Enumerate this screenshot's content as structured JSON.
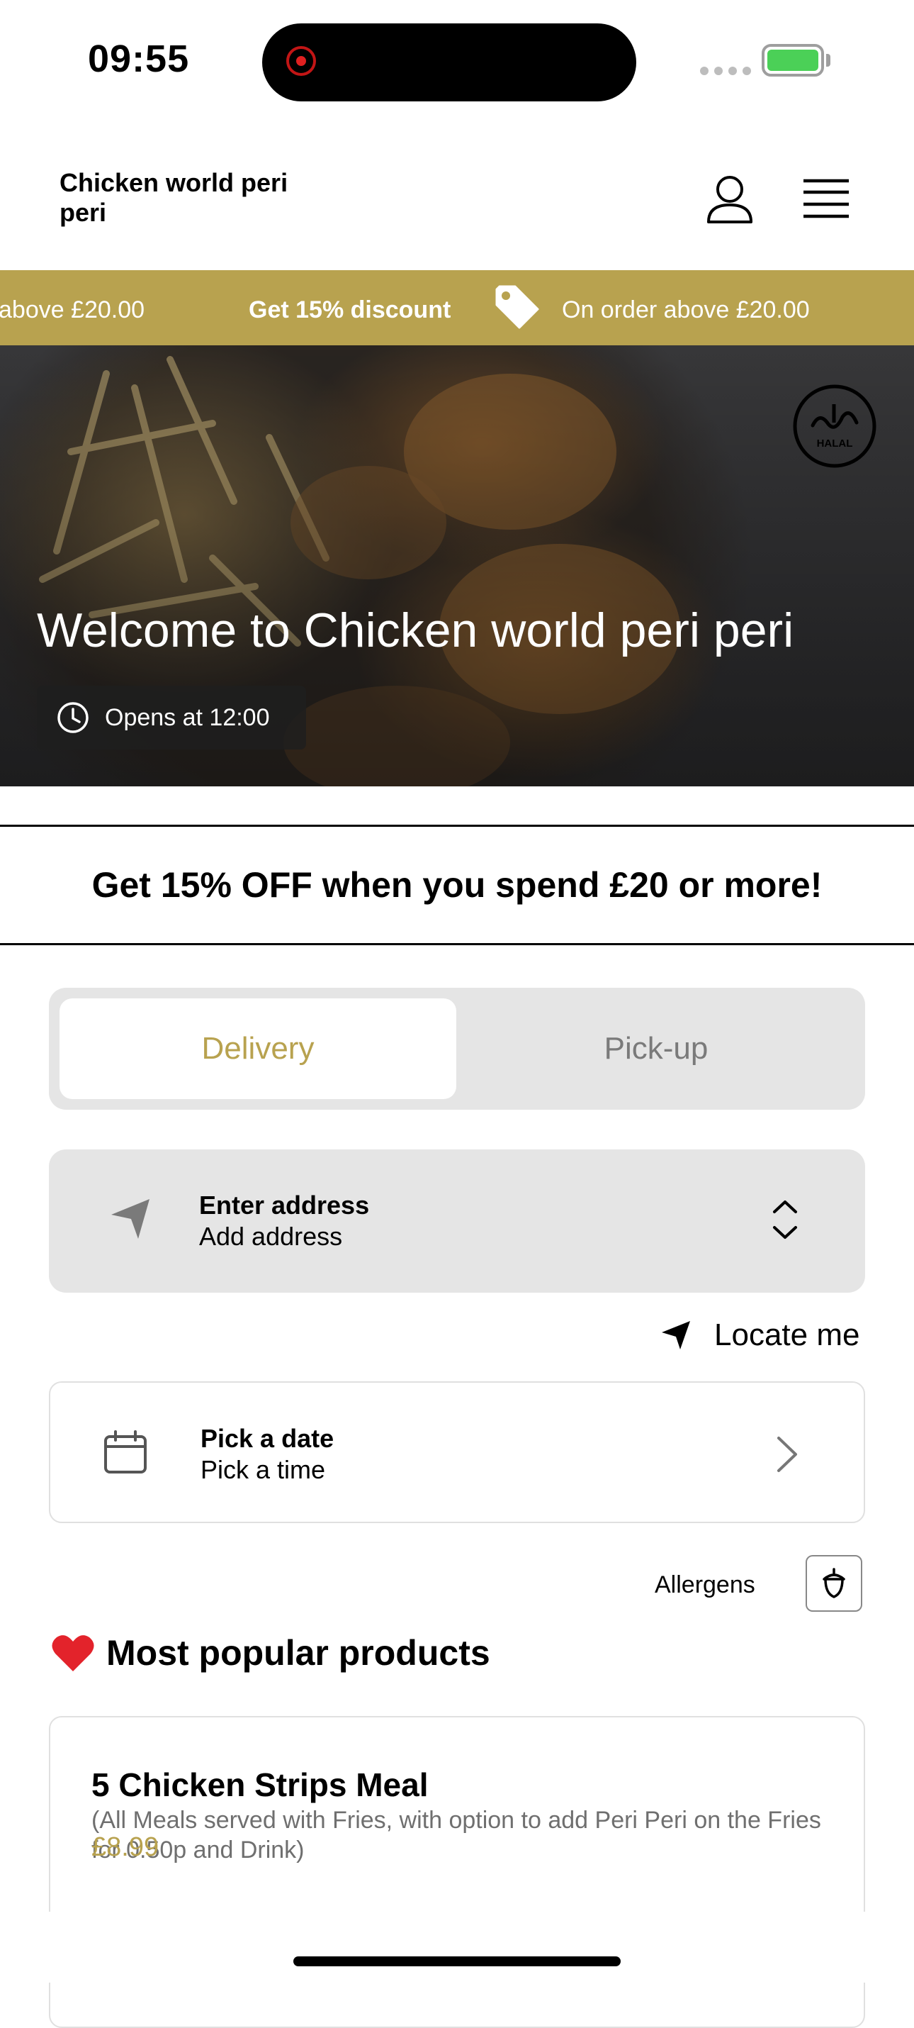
{
  "status_bar": {
    "time": "09:55"
  },
  "header": {
    "brand": "Chicken world peri peri"
  },
  "ticker": {
    "left_tail": "above £20.00",
    "headline": "Get 15% discount",
    "detail": "On order above £20.00"
  },
  "hero": {
    "welcome": "Welcome to Chicken world peri peri",
    "opens": "Opens at 12:00",
    "halal_badge": "HALAL"
  },
  "promo_banner": "Get 15% OFF when you spend £20 or more!",
  "order_mode": {
    "delivery": "Delivery",
    "pickup": "Pick-up",
    "selected": "Delivery"
  },
  "address": {
    "title": "Enter address",
    "subtitle": "Add address"
  },
  "locate_me": "Locate me",
  "schedule": {
    "title": "Pick a date",
    "subtitle": "Pick a time"
  },
  "allergens": "Allergens",
  "popular": {
    "heading": "Most popular products",
    "products": [
      {
        "name": "5 Chicken Strips Meal",
        "description": "(All Meals served with Fries, with option to add Peri Peri on the Fries for 0.50p and Drink)",
        "price": "£8.99"
      }
    ]
  },
  "colors": {
    "accent": "#b8a24f",
    "battery": "#4bd057",
    "recording": "#e02020"
  },
  "icons": [
    "user-icon",
    "menu-icon",
    "tag-icon",
    "halal-badge-icon",
    "clock-icon",
    "navigation-arrow-icon",
    "chevron-up-down-icon",
    "locate-arrow-icon",
    "calendar-icon",
    "chevron-right-icon",
    "acorn-icon",
    "heart-icon"
  ]
}
